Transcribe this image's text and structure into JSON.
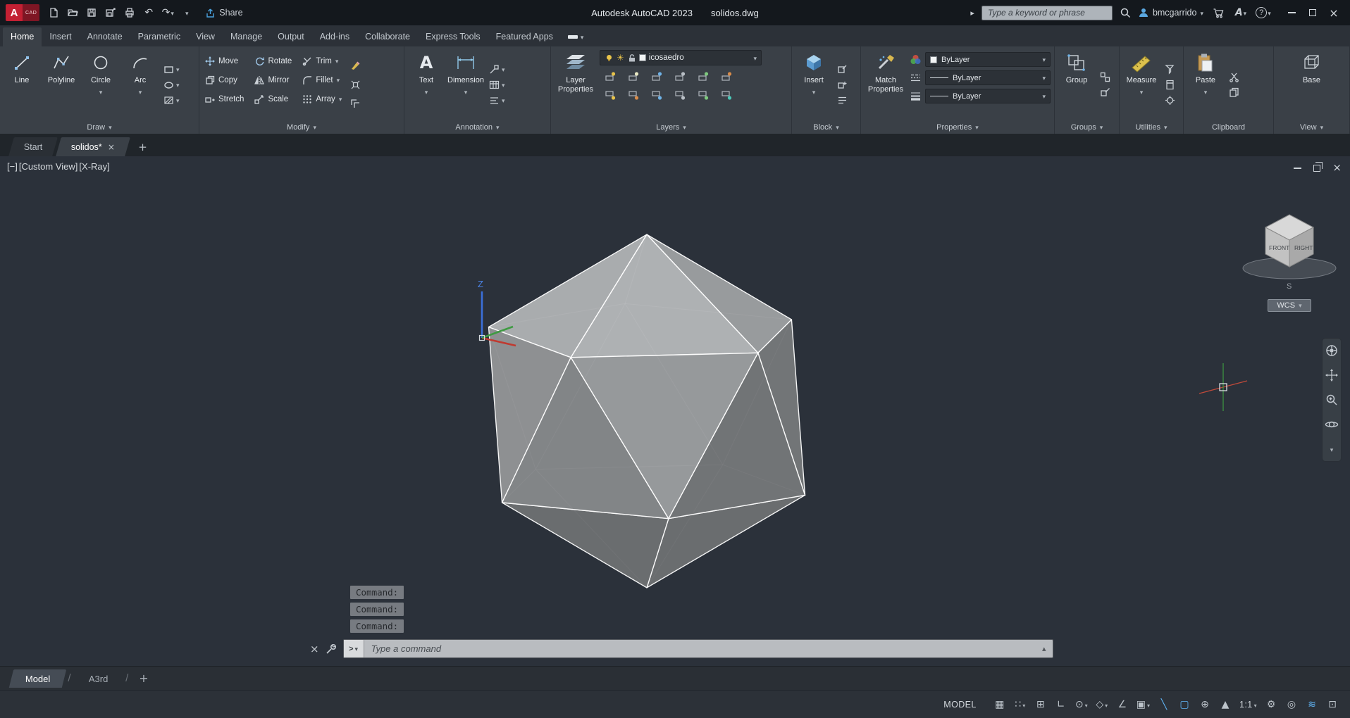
{
  "titlebar": {
    "logo": "A",
    "logo_sub": "CAD",
    "share_label": "Share",
    "app_title": "Autodesk AutoCAD 2023",
    "doc_title": "solidos.dwg",
    "search_placeholder": "Type a keyword or phrase",
    "username": "bmcgarrido"
  },
  "icons": {
    "undo": "↶",
    "redo": "↷",
    "close": "×",
    "help": "?",
    "autodesk_a": "A",
    "collapse_arrow": "▸",
    "prompt": ">",
    "expand_history": "▴",
    "plus": "+",
    "text_glyph": "A",
    "sun": "☀"
  },
  "ribbon": {
    "tabs": [
      "Home",
      "Insert",
      "Annotate",
      "Parametric",
      "View",
      "Manage",
      "Output",
      "Add-ins",
      "Collaborate",
      "Express Tools",
      "Featured Apps"
    ],
    "active_tab": "Home"
  },
  "panels": {
    "draw": {
      "label": "Draw",
      "line": "Line",
      "polyline": "Polyline",
      "circle": "Circle",
      "arc": "Arc"
    },
    "modify": {
      "label": "Modify",
      "items": [
        "Move",
        "Rotate",
        "Trim",
        "Copy",
        "Mirror",
        "Fillet",
        "Stretch",
        "Scale",
        "Array"
      ]
    },
    "annotation": {
      "label": "Annotation",
      "text": "Text",
      "dimension": "Dimension"
    },
    "layers": {
      "label": "Layers",
      "layer_properties": "Layer Properties",
      "current_layer": "icosaedro"
    },
    "block": {
      "label": "Block",
      "insert": "Insert"
    },
    "properties": {
      "label": "Properties",
      "match": "Match Properties",
      "color_value": "ByLayer",
      "linetype_value": "ByLayer",
      "lineweight_value": "ByLayer"
    },
    "groups": {
      "label": "Groups",
      "group": "Group"
    },
    "utilities": {
      "label": "Utilities",
      "measure": "Measure"
    },
    "clipboard": {
      "label": "Clipboard",
      "paste": "Paste"
    },
    "view": {
      "label": "View",
      "base": "Base"
    }
  },
  "file_tabs": {
    "start": "Start",
    "document": "solidos*"
  },
  "viewport": {
    "controls_label": "[−]",
    "view_label": "[Custom View]",
    "visual_style_label": "[X-Ray]",
    "viewcube": {
      "front": "FRONT",
      "right": "RIGHT",
      "south": "S"
    },
    "ucs_label": "WCS",
    "ucs_axis_z": "Z"
  },
  "command": {
    "history": [
      "Command:",
      "Command:",
      "Command:"
    ],
    "placeholder": "Type a command"
  },
  "layout_tabs": {
    "model": "Model",
    "layout1": "A3rd"
  },
  "statusbar": {
    "model_label": "MODEL",
    "scale_label": "1:1",
    "glyphs": {
      "grid": "▦",
      "snap": "∷",
      "infer": "⊞",
      "ortho": "∟",
      "polar": "⊙",
      "isodraft": "◇",
      "otrack": "∠",
      "osnap": "▣",
      "lineweight": "╲",
      "selection_cycling": "▢",
      "dynamic_ucs": "⊕",
      "annotation_vis": "▲",
      "gear": "⚙",
      "isolate": "◎",
      "graphics": "≋",
      "clean_screen": "⊡"
    }
  }
}
